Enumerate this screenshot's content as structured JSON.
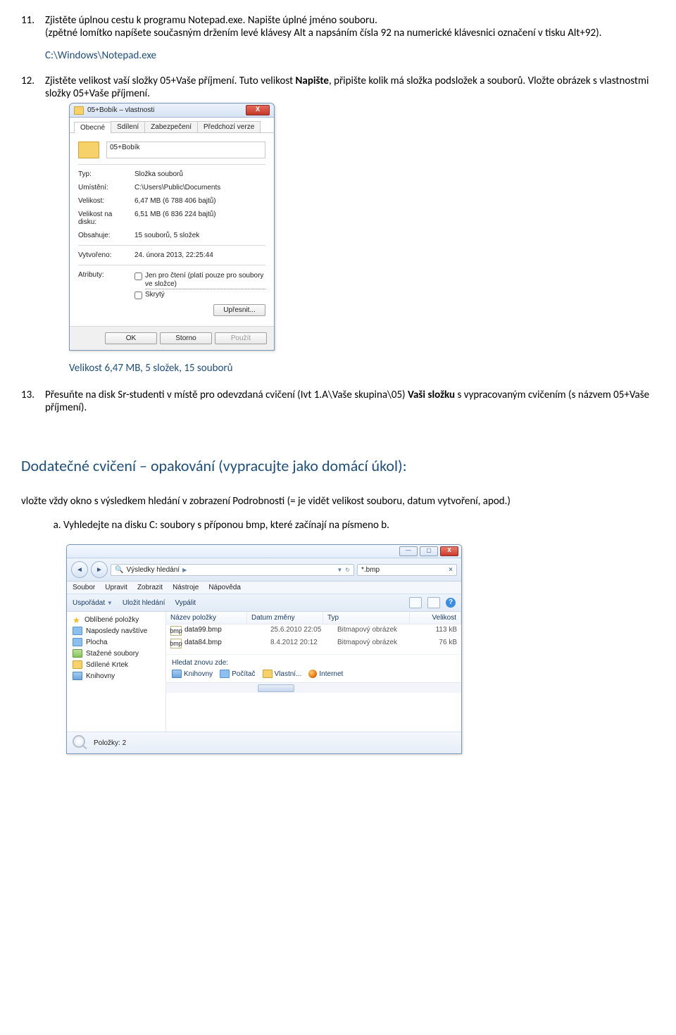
{
  "tasks": {
    "t11": {
      "num": "11.",
      "text_a": "Zjistěte úplnou cestu k programu Notepad.exe. Napište úplné jméno souboru.",
      "text_b": "(zpětné lomítko napíšete současným držením levé klávesy Alt a napsáním čísla 92 na numerické klávesnici označení v tisku Alt+92).",
      "answer": "C:\\Windows\\Notepad.exe"
    },
    "t12": {
      "num": "12.",
      "text_a": "Zjistěte velikost vaší složky 05+Vaše příjmení. Tuto velikost ",
      "bold": "Napište",
      "text_b": ", připište kolik má složka podsložek a souborů. Vložte obrázek s vlastnostmi složky 05+Vaše příjmení."
    },
    "t13": {
      "num": "13.",
      "text_a": "Přesuňte na disk Sr-studenti v místě pro odevzdaná cvičení (Ivt 1.A\\Vaše skupina\\05) ",
      "bold": "Vaši složku",
      "text_b": " s vypracovaným cvičením (s názvem 05+Vaše příjmení)."
    }
  },
  "sizeNote": "Velikost 6,47 MB, 5 složek, 15 souborů",
  "props": {
    "title": "05+Bobík – vlastnosti",
    "tabs": [
      "Obecné",
      "Sdílení",
      "Zabezpečení",
      "Předchozí verze"
    ],
    "name": "05+Bobík",
    "rows": {
      "type_l": "Typ:",
      "type": "Složka souborů",
      "loc_l": "Umístění:",
      "loc": "C:\\Users\\Public\\Documents",
      "size_l": "Velikost:",
      "size": "6,47 MB (6 788 406 bajtů)",
      "disk_l": "Velikost na disku:",
      "disk": "6,51 MB (6 836 224 bajtů)",
      "cont_l": "Obsahuje:",
      "cont": "15 souborů, 5 složek",
      "crt_l": "Vytvořeno:",
      "crt": "24. února 2013, 22:25:44",
      "attr_l": "Atributy:"
    },
    "attr_ro": "Jen pro čtení (platí pouze pro soubory ve složce)",
    "attr_hidden": "Skrytý",
    "btn_adv": "Upřesnit...",
    "btn_ok": "OK",
    "btn_cancel": "Storno",
    "btn_apply": "Použít"
  },
  "extraHeading": "Dodatečné cvičení – opakování (vypracujte jako domácí úkol):",
  "extraIntro": "vložte vždy okno s výsledkem hledání v zobrazení Podrobnosti (= je vidět velikost souboru, datum vytvoření, apod.)",
  "subA": "Vyhledejte na disku C: soubory s příponou bmp, které začínají na písmeno b.",
  "explorer": {
    "breadcrumb": "Výsledky hledání",
    "search": "*.bmp",
    "menu": [
      "Soubor",
      "Upravit",
      "Zobrazit",
      "Nástroje",
      "Nápověda"
    ],
    "toolbar": {
      "org": "Uspořádat",
      "save": "Uložit hledání",
      "burn": "Vypálit"
    },
    "sidebar": {
      "fav": "Oblíbené položky",
      "items": [
        "Naposledy navštíve",
        "Plocha",
        "Stažené soubory",
        "Sdílené Krtek",
        "Knihovny"
      ]
    },
    "cols": {
      "name": "Název položky",
      "date": "Datum změny",
      "type": "Typ",
      "size": "Velikost"
    },
    "files": [
      {
        "name": "data99.bmp",
        "date": "25.6.2010 22:05",
        "type": "Bitmapový obrázek",
        "size": "113 kB"
      },
      {
        "name": "data84.bmp",
        "date": "8.4.2012 20:12",
        "type": "Bitmapový obrázek",
        "size": "76 kB"
      }
    ],
    "again": "Hledat znovu zde:",
    "locs": [
      "Knihovny",
      "Počítač",
      "Vlastní...",
      "Internet"
    ],
    "status": "Položky: 2"
  }
}
